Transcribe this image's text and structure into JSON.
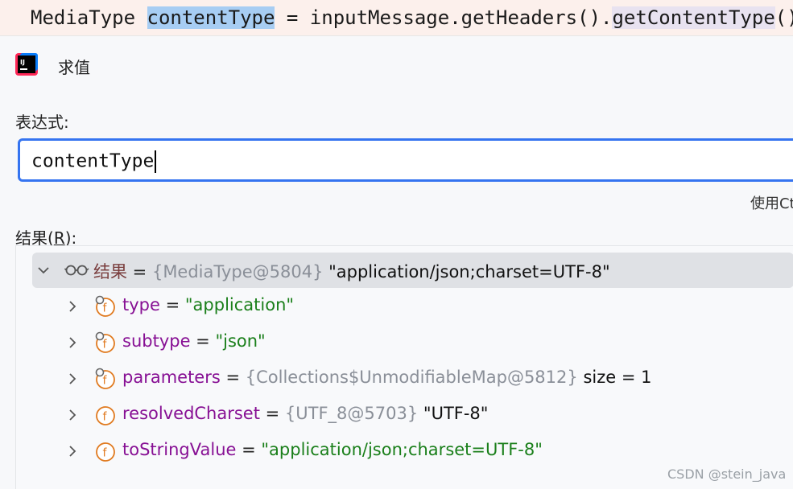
{
  "code_line": {
    "prefix": "MediaType ",
    "highlighted": "contentType",
    "middle": " = inputMessage.getHeaders().",
    "method": "getContentType",
    "suffix": "();"
  },
  "dialog": {
    "title": "求值",
    "expression_label": "表达式:",
    "expression_value": "contentType",
    "hint": "使用Ct",
    "result_label_pre": "结果(",
    "result_label_mnemonic": "R",
    "result_label_post": "):"
  },
  "tree": {
    "root": {
      "name": "结果",
      "eq": " = ",
      "ref": "{MediaType@5804}",
      "value": " \"application/json;charset=UTF-8\""
    },
    "children": [
      {
        "name": "type",
        "eq": " = ",
        "ref": "",
        "value": "\"application\"",
        "value_style": "str",
        "extra": "",
        "icon": "field-lock"
      },
      {
        "name": "subtype",
        "eq": " = ",
        "ref": "",
        "value": "\"json\"",
        "value_style": "str",
        "extra": "",
        "icon": "field-lock"
      },
      {
        "name": "parameters",
        "eq": " = ",
        "ref": "{Collections$UnmodifiableMap@5812}",
        "value": "",
        "value_style": "plain",
        "extra": "  size = 1",
        "icon": "field-lock"
      },
      {
        "name": "resolvedCharset",
        "eq": " = ",
        "ref": "{UTF_8@5703}",
        "value": " \"UTF-8\"",
        "value_style": "plain",
        "extra": "",
        "icon": "field"
      },
      {
        "name": "toStringValue",
        "eq": " = ",
        "ref": "",
        "value": "\"application/json;charset=UTF-8\"",
        "value_style": "str",
        "extra": "",
        "icon": "field"
      }
    ]
  },
  "watermark": "CSDN @stein_java",
  "colors": {
    "focus_border": "#3574f0",
    "string": "#1a7f1a",
    "field_icon": "#e07a1f",
    "selection": "#dfe1e5"
  }
}
